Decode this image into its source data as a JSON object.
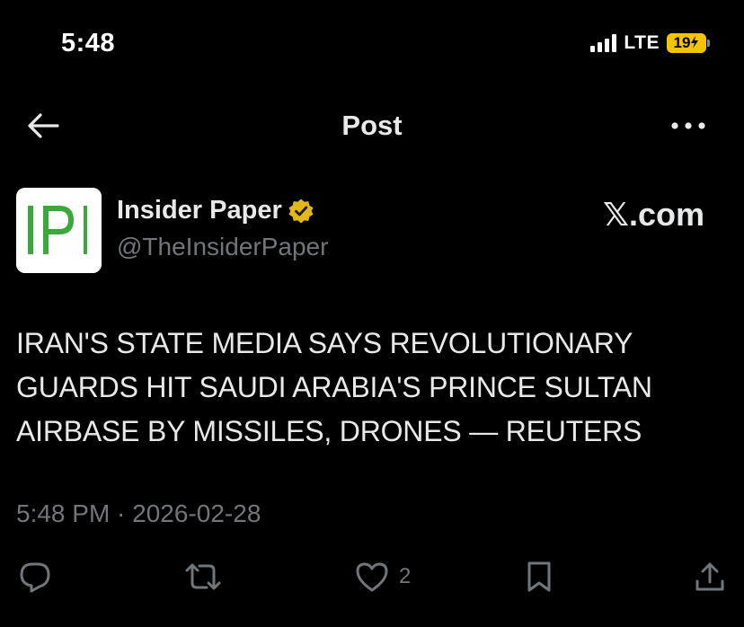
{
  "status_bar": {
    "time": "5:48",
    "network": "LTE",
    "battery_level": "19",
    "battery_charging": true,
    "battery_color": "#f5c400"
  },
  "header": {
    "title": "Post",
    "back_icon": "arrow-left-icon",
    "more_icon": "more-horizontal-icon"
  },
  "author": {
    "avatar_text": "IP",
    "name": "Insider Paper",
    "verified_icon": "gold-verified-badge-icon",
    "handle": "@TheInsiderPaper",
    "watermark": "𝕏.com"
  },
  "post": {
    "lines": [
      "IRAN'S STATE MEDIA SAYS REVOLUTIONARY",
      "GUARDS HIT SAUDI ARABIA'S PRINCE SULTAN",
      "AIRBASE BY MISSILES, DRONES — REUTERS"
    ],
    "timestamp": "5:48 PM · 2026-02-28"
  },
  "actions": {
    "reply_icon": "reply-icon",
    "repost_icon": "repost-icon",
    "like_icon": "heart-icon",
    "like_count": "2",
    "bookmark_icon": "bookmark-icon",
    "share_icon": "share-icon"
  },
  "colors": {
    "background": "#000000",
    "text_primary": "#e7e9ea",
    "text_secondary": "#71767b",
    "avatar_green": "#3aa83a",
    "verified_gold": "#e2b719"
  }
}
